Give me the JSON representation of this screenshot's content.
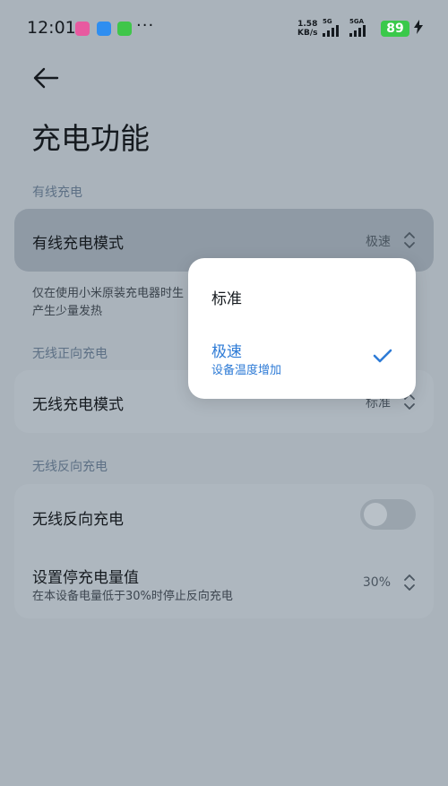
{
  "status_bar": {
    "time": "12:01",
    "more": "···",
    "net_speed_value": "1.58",
    "net_speed_unit": "KB/s",
    "sim1": "5G",
    "sim2": "5GA",
    "battery": "89",
    "charging_icon": "bolt-icon"
  },
  "page": {
    "title": "充电功能"
  },
  "wired": {
    "section": "有线充电",
    "mode_label": "有线充电模式",
    "mode_value": "极速",
    "desc_line1": "仅在使用小米原装充电器时生",
    "desc_line2": "产生少量发热"
  },
  "wireless": {
    "section": "无线正向充电",
    "mode_label": "无线充电模式",
    "mode_value": "标准"
  },
  "reverse": {
    "section": "无线反向充电",
    "toggle_label": "无线反向充电",
    "toggle_on": false,
    "threshold_label": "设置停充电量值",
    "threshold_sub": "在本设备电量低于30%时停止反向充电",
    "threshold_value": "30%"
  },
  "popup": {
    "option1": "标准",
    "option2": "极速",
    "option2_sub": "设备温度增加",
    "selected": "极速"
  },
  "colors": {
    "accent": "#2e7bd6",
    "battery": "#3ac94a"
  }
}
